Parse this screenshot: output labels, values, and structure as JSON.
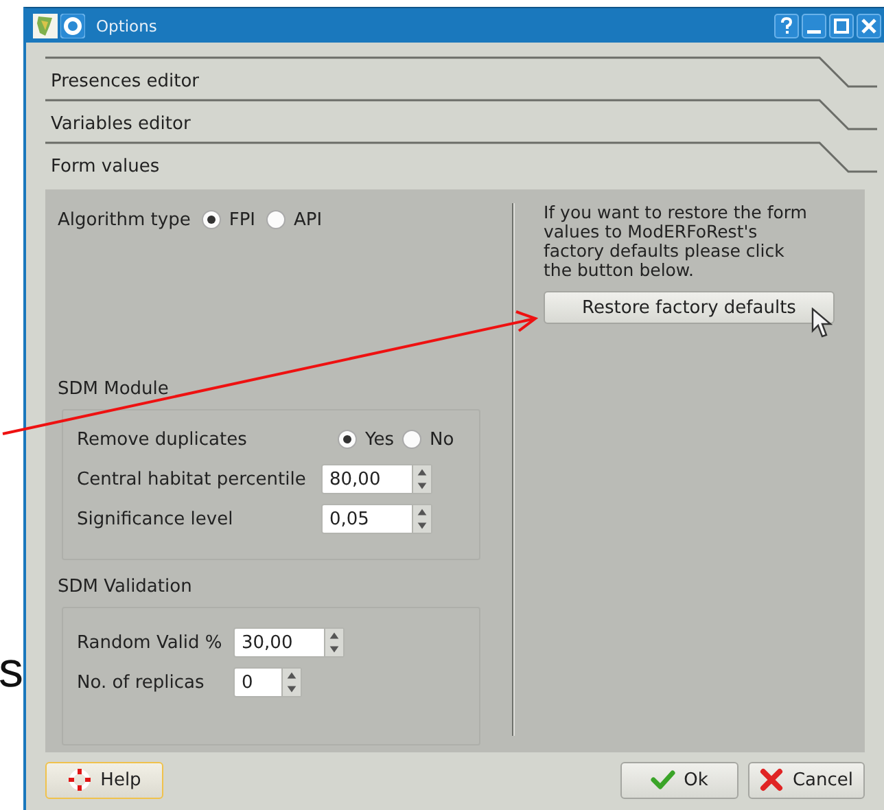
{
  "background_text": "s",
  "window": {
    "title": "Options"
  },
  "sections": [
    {
      "label": "Presences editor"
    },
    {
      "label": "Variables editor"
    },
    {
      "label": "Form values",
      "content": {
        "algorithm": {
          "label": "Algorithm type",
          "options": [
            {
              "label": "FPI",
              "selected": true
            },
            {
              "label": "API",
              "selected": false
            }
          ]
        },
        "groups": [
          {
            "title": "SDM Module",
            "rows": [
              {
                "kind": "radio",
                "label": "Remove duplicates",
                "options": [
                  {
                    "label": "Yes",
                    "selected": true
                  },
                  {
                    "label": "No",
                    "selected": false
                  }
                ]
              },
              {
                "kind": "spin",
                "label": "Central habitat percentile",
                "value": "80,00"
              },
              {
                "kind": "spin",
                "label": "Significance level",
                "value": "0,05"
              }
            ]
          },
          {
            "title": "SDM Validation",
            "rows": [
              {
                "kind": "spin",
                "label": "Random Valid %",
                "value": "30,00"
              },
              {
                "kind": "spin",
                "label": "No. of replicas",
                "value": "0"
              }
            ]
          }
        ],
        "restore": {
          "text": "If you want to restore the form values to ModERFoRest's factory defaults please click the button below.",
          "button": "Restore factory defaults"
        }
      }
    }
  ],
  "buttons": [
    {
      "kind": "help",
      "label": "Help",
      "focused": true
    },
    {
      "kind": "ok",
      "label": "Ok",
      "focused": false
    },
    {
      "kind": "cancel",
      "label": "Cancel",
      "focused": false
    }
  ]
}
